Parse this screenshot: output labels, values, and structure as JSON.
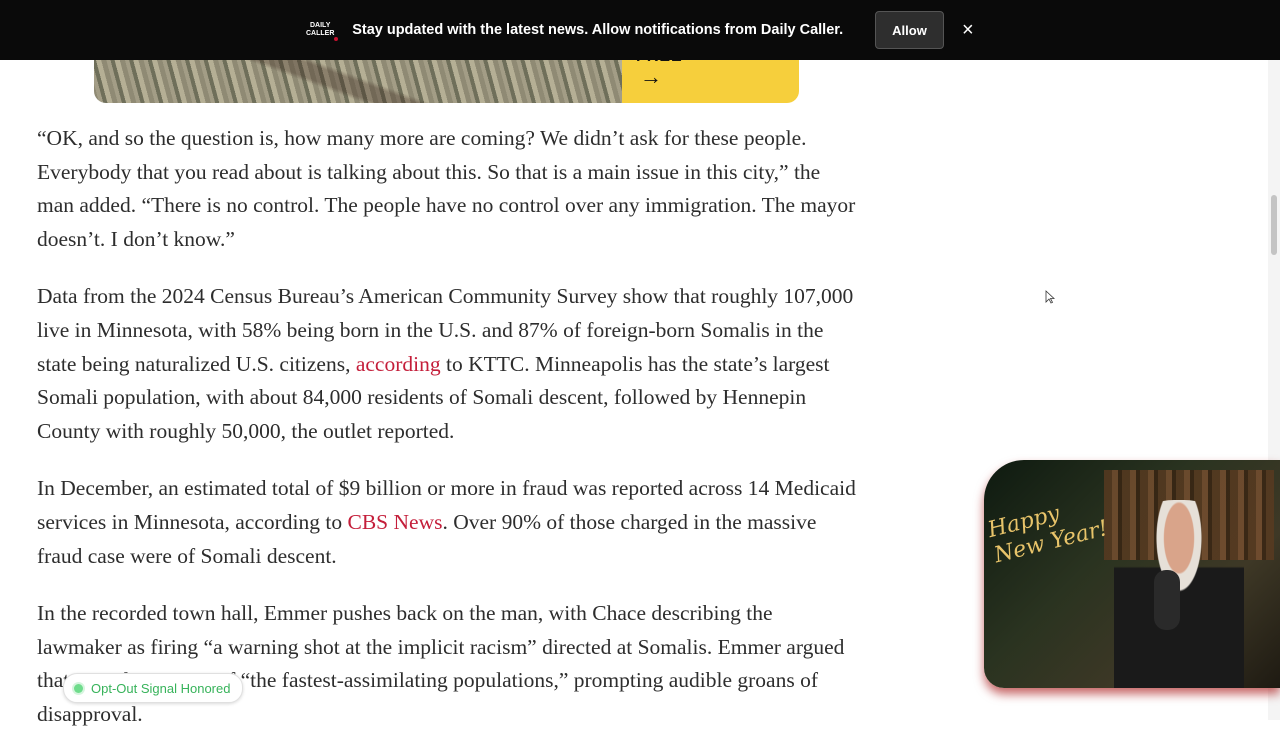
{
  "notification": {
    "logo_line1": "DAILY",
    "logo_line2": "CALLER",
    "message": "Stay updated with the latest news. Allow notifications from Daily Caller.",
    "allow_label": "Allow",
    "close_symbol": "×"
  },
  "ad": {
    "cta_text": "FREE",
    "cta_arrow": "→"
  },
  "article": {
    "p1": "“OK, and so the question is, how many more are coming? We didn’t ask for these people. Everybody that you read about is talking about this. So that is a main issue in this city,” the man added. “There is no control. The people have no control over any immigration. The mayor doesn’t. I don’t know.”",
    "p2_before": "Data from the 2024 Census Bureau’s American Community Survey show that roughly 107,000 live in Minnesota, with 58% being born in the U.S. and 87% of foreign-born Somalis in the state being naturalized U.S. citizens, ",
    "p2_link": "according",
    "p2_after": " to KTTC. Minneapolis has the state’s largest Somali population, with about 84,000 residents of Somali descent, followed by Hennepin County with roughly 50,000, the outlet reported.",
    "p3_before": "In December, an estimated total of $9 billion or more in fraud was reported across 14 Medicaid services in Minnesota, according to ",
    "p3_link": "CBS News",
    "p3_after": ". Over 90% of those charged in the massive fraud case were of Somali descent.",
    "p4": "In the recorded town hall, Emmer pushes back on the man, with Chace describing the lawmaker as firing “a warning shot at the implicit racism” directed at Somalis. Emmer argued that Somalis are one of “the fastest-assimilating populations,” prompting audible groans of disapproval."
  },
  "video": {
    "overlay_line1": "Happy",
    "overlay_line2": "New Year!"
  },
  "optout": {
    "label": "Opt-Out Signal Honored"
  }
}
